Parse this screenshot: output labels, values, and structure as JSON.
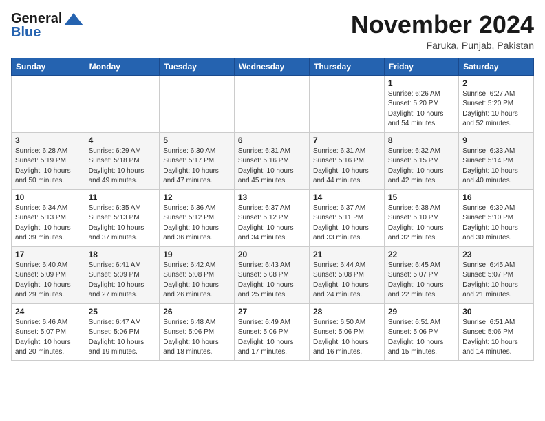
{
  "header": {
    "logo_line1": "General",
    "logo_line2": "Blue",
    "month_title": "November 2024",
    "location": "Faruka, Punjab, Pakistan"
  },
  "days_of_week": [
    "Sunday",
    "Monday",
    "Tuesday",
    "Wednesday",
    "Thursday",
    "Friday",
    "Saturday"
  ],
  "weeks": [
    [
      {
        "num": "",
        "info": ""
      },
      {
        "num": "",
        "info": ""
      },
      {
        "num": "",
        "info": ""
      },
      {
        "num": "",
        "info": ""
      },
      {
        "num": "",
        "info": ""
      },
      {
        "num": "1",
        "info": "Sunrise: 6:26 AM\nSunset: 5:20 PM\nDaylight: 10 hours\nand 54 minutes."
      },
      {
        "num": "2",
        "info": "Sunrise: 6:27 AM\nSunset: 5:20 PM\nDaylight: 10 hours\nand 52 minutes."
      }
    ],
    [
      {
        "num": "3",
        "info": "Sunrise: 6:28 AM\nSunset: 5:19 PM\nDaylight: 10 hours\nand 50 minutes."
      },
      {
        "num": "4",
        "info": "Sunrise: 6:29 AM\nSunset: 5:18 PM\nDaylight: 10 hours\nand 49 minutes."
      },
      {
        "num": "5",
        "info": "Sunrise: 6:30 AM\nSunset: 5:17 PM\nDaylight: 10 hours\nand 47 minutes."
      },
      {
        "num": "6",
        "info": "Sunrise: 6:31 AM\nSunset: 5:16 PM\nDaylight: 10 hours\nand 45 minutes."
      },
      {
        "num": "7",
        "info": "Sunrise: 6:31 AM\nSunset: 5:16 PM\nDaylight: 10 hours\nand 44 minutes."
      },
      {
        "num": "8",
        "info": "Sunrise: 6:32 AM\nSunset: 5:15 PM\nDaylight: 10 hours\nand 42 minutes."
      },
      {
        "num": "9",
        "info": "Sunrise: 6:33 AM\nSunset: 5:14 PM\nDaylight: 10 hours\nand 40 minutes."
      }
    ],
    [
      {
        "num": "10",
        "info": "Sunrise: 6:34 AM\nSunset: 5:13 PM\nDaylight: 10 hours\nand 39 minutes."
      },
      {
        "num": "11",
        "info": "Sunrise: 6:35 AM\nSunset: 5:13 PM\nDaylight: 10 hours\nand 37 minutes."
      },
      {
        "num": "12",
        "info": "Sunrise: 6:36 AM\nSunset: 5:12 PM\nDaylight: 10 hours\nand 36 minutes."
      },
      {
        "num": "13",
        "info": "Sunrise: 6:37 AM\nSunset: 5:12 PM\nDaylight: 10 hours\nand 34 minutes."
      },
      {
        "num": "14",
        "info": "Sunrise: 6:37 AM\nSunset: 5:11 PM\nDaylight: 10 hours\nand 33 minutes."
      },
      {
        "num": "15",
        "info": "Sunrise: 6:38 AM\nSunset: 5:10 PM\nDaylight: 10 hours\nand 32 minutes."
      },
      {
        "num": "16",
        "info": "Sunrise: 6:39 AM\nSunset: 5:10 PM\nDaylight: 10 hours\nand 30 minutes."
      }
    ],
    [
      {
        "num": "17",
        "info": "Sunrise: 6:40 AM\nSunset: 5:09 PM\nDaylight: 10 hours\nand 29 minutes."
      },
      {
        "num": "18",
        "info": "Sunrise: 6:41 AM\nSunset: 5:09 PM\nDaylight: 10 hours\nand 27 minutes."
      },
      {
        "num": "19",
        "info": "Sunrise: 6:42 AM\nSunset: 5:08 PM\nDaylight: 10 hours\nand 26 minutes."
      },
      {
        "num": "20",
        "info": "Sunrise: 6:43 AM\nSunset: 5:08 PM\nDaylight: 10 hours\nand 25 minutes."
      },
      {
        "num": "21",
        "info": "Sunrise: 6:44 AM\nSunset: 5:08 PM\nDaylight: 10 hours\nand 24 minutes."
      },
      {
        "num": "22",
        "info": "Sunrise: 6:45 AM\nSunset: 5:07 PM\nDaylight: 10 hours\nand 22 minutes."
      },
      {
        "num": "23",
        "info": "Sunrise: 6:45 AM\nSunset: 5:07 PM\nDaylight: 10 hours\nand 21 minutes."
      }
    ],
    [
      {
        "num": "24",
        "info": "Sunrise: 6:46 AM\nSunset: 5:07 PM\nDaylight: 10 hours\nand 20 minutes."
      },
      {
        "num": "25",
        "info": "Sunrise: 6:47 AM\nSunset: 5:06 PM\nDaylight: 10 hours\nand 19 minutes."
      },
      {
        "num": "26",
        "info": "Sunrise: 6:48 AM\nSunset: 5:06 PM\nDaylight: 10 hours\nand 18 minutes."
      },
      {
        "num": "27",
        "info": "Sunrise: 6:49 AM\nSunset: 5:06 PM\nDaylight: 10 hours\nand 17 minutes."
      },
      {
        "num": "28",
        "info": "Sunrise: 6:50 AM\nSunset: 5:06 PM\nDaylight: 10 hours\nand 16 minutes."
      },
      {
        "num": "29",
        "info": "Sunrise: 6:51 AM\nSunset: 5:06 PM\nDaylight: 10 hours\nand 15 minutes."
      },
      {
        "num": "30",
        "info": "Sunrise: 6:51 AM\nSunset: 5:06 PM\nDaylight: 10 hours\nand 14 minutes."
      }
    ]
  ]
}
